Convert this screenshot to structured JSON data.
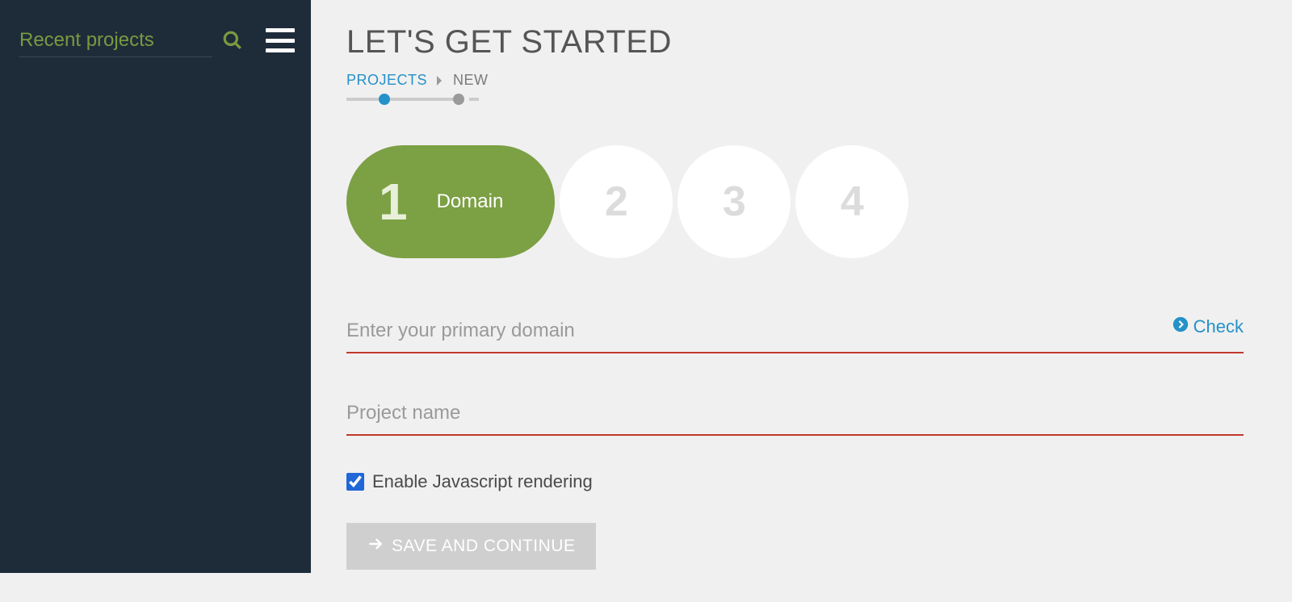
{
  "sidebar": {
    "search_placeholder": "Recent projects"
  },
  "header": {
    "title": "LET'S GET STARTED"
  },
  "breadcrumb": {
    "projects": "PROJECTS",
    "current": "NEW"
  },
  "steps": {
    "active": {
      "num": "1",
      "label": "Domain"
    },
    "inactive": [
      "2",
      "3",
      "4"
    ]
  },
  "form": {
    "domain_placeholder": "Enter your primary domain",
    "check_label": "Check",
    "name_placeholder": "Project name",
    "js_checkbox_label": "Enable Javascript rendering",
    "js_checked": true,
    "save_label": "SAVE AND CONTINUE"
  }
}
